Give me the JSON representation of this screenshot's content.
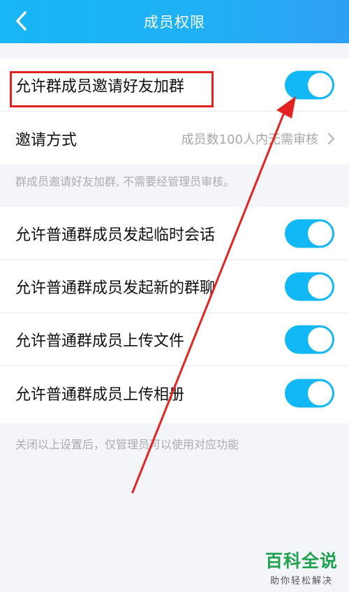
{
  "header": {
    "title": "成员权限",
    "back_icon": "chevron-left-icon"
  },
  "invite_group": {
    "allow_invite_label": "允许群成员邀请好友加群",
    "allow_invite_on": true,
    "invite_method_label": "邀请方式",
    "invite_method_value": "成员数100人内无需审核",
    "chevron_icon": "chevron-right-icon"
  },
  "invite_note": "群成员邀请好友加群, 不需要经管理员审核。",
  "permissions": [
    {
      "label": "允许普通群成员发起临时会话",
      "on": true
    },
    {
      "label": "允许普通群成员发起新的群聊",
      "on": true
    },
    {
      "label": "允许普通群成员上传文件",
      "on": true
    },
    {
      "label": "允许普通群成员上传相册",
      "on": true
    }
  ],
  "permissions_note": "关闭以上设置后，仅管理员可以使用对应功能",
  "watermark": {
    "main": "百科全说",
    "sub": "助你轻松解决"
  },
  "colors": {
    "header_bg": "#1fb1f5",
    "toggle_on": "#12b7f5",
    "highlight": "#e32222",
    "page_bg": "#f4f5f9",
    "watermark": "#1ea24f"
  }
}
